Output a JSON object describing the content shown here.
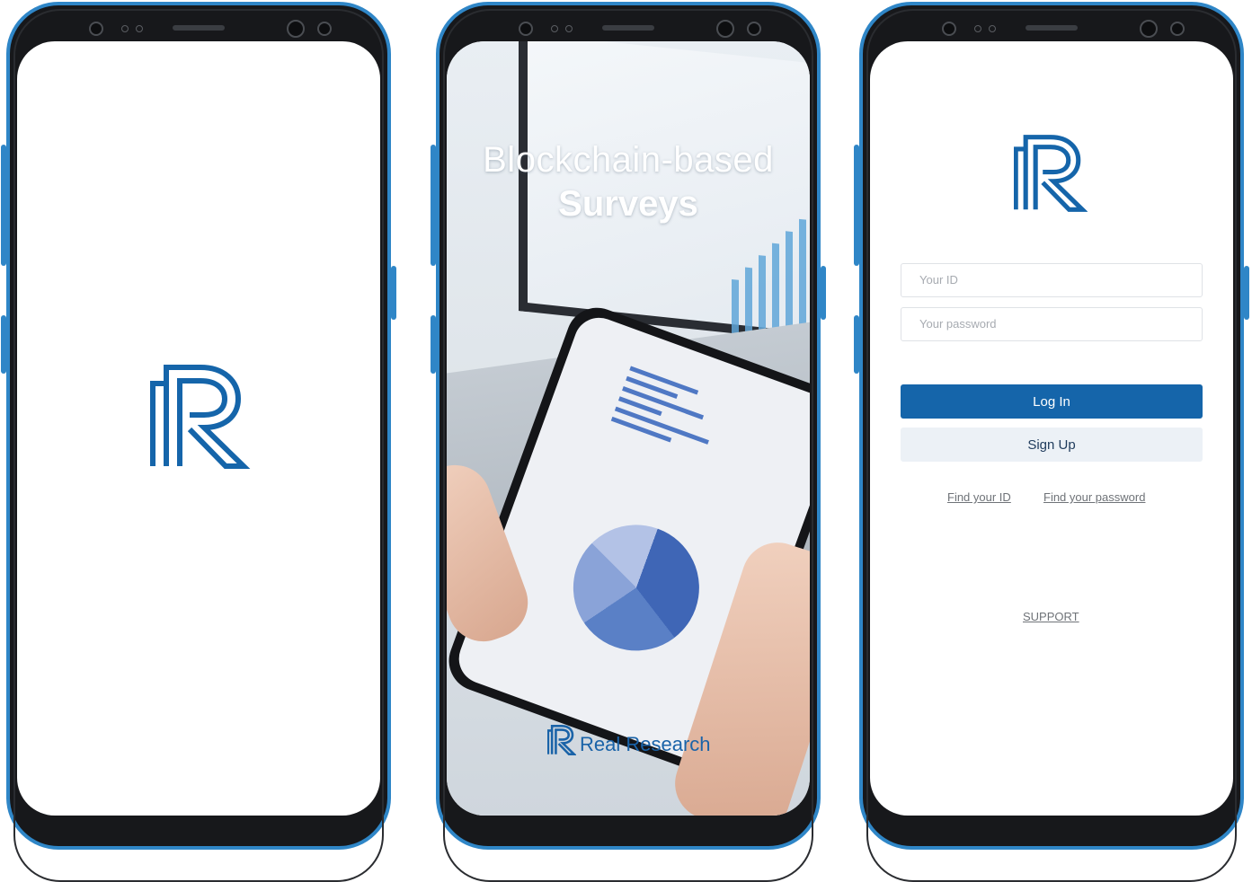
{
  "colors": {
    "frame": "#2f86c7",
    "brand_blue": "#1565aa"
  },
  "splash": {
    "logo_icon": "rr-logo-icon"
  },
  "survey": {
    "headline_line1": "Blockchain-based",
    "headline_line2": "Surveys",
    "brand_name": "Real Research"
  },
  "login": {
    "id_placeholder": "Your ID",
    "password_placeholder": "Your password",
    "login_label": "Log In",
    "signup_label": "Sign Up",
    "find_id": "Find your ID",
    "find_password": "Find your password",
    "support": "SUPPORT"
  }
}
